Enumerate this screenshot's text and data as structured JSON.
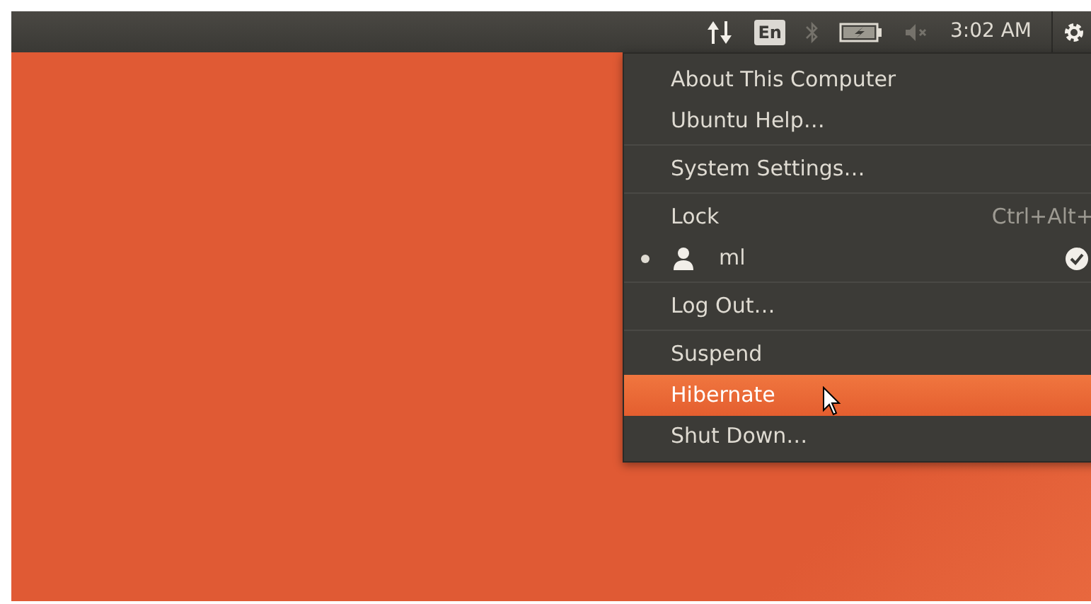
{
  "top_panel": {
    "keyboard_layout": "En",
    "clock": "3:02 AM"
  },
  "session_menu": {
    "items": [
      {
        "kind": "item",
        "label": "About This Computer",
        "selected": false
      },
      {
        "kind": "item",
        "label": "Ubuntu Help…",
        "selected": false
      },
      {
        "kind": "separator"
      },
      {
        "kind": "item",
        "label": "System Settings…",
        "selected": false
      },
      {
        "kind": "separator"
      },
      {
        "kind": "item",
        "label": "Lock",
        "shortcut": "Ctrl+Alt+",
        "selected": false
      },
      {
        "kind": "user",
        "label": "ml",
        "selected": false,
        "active": true,
        "logged_in": true
      },
      {
        "kind": "separator"
      },
      {
        "kind": "item",
        "label": "Log Out…",
        "selected": false
      },
      {
        "kind": "separator"
      },
      {
        "kind": "item",
        "label": "Suspend",
        "selected": false
      },
      {
        "kind": "item",
        "label": "Hibernate",
        "selected": true
      },
      {
        "kind": "item",
        "label": "Shut Down…",
        "selected": false
      }
    ]
  }
}
